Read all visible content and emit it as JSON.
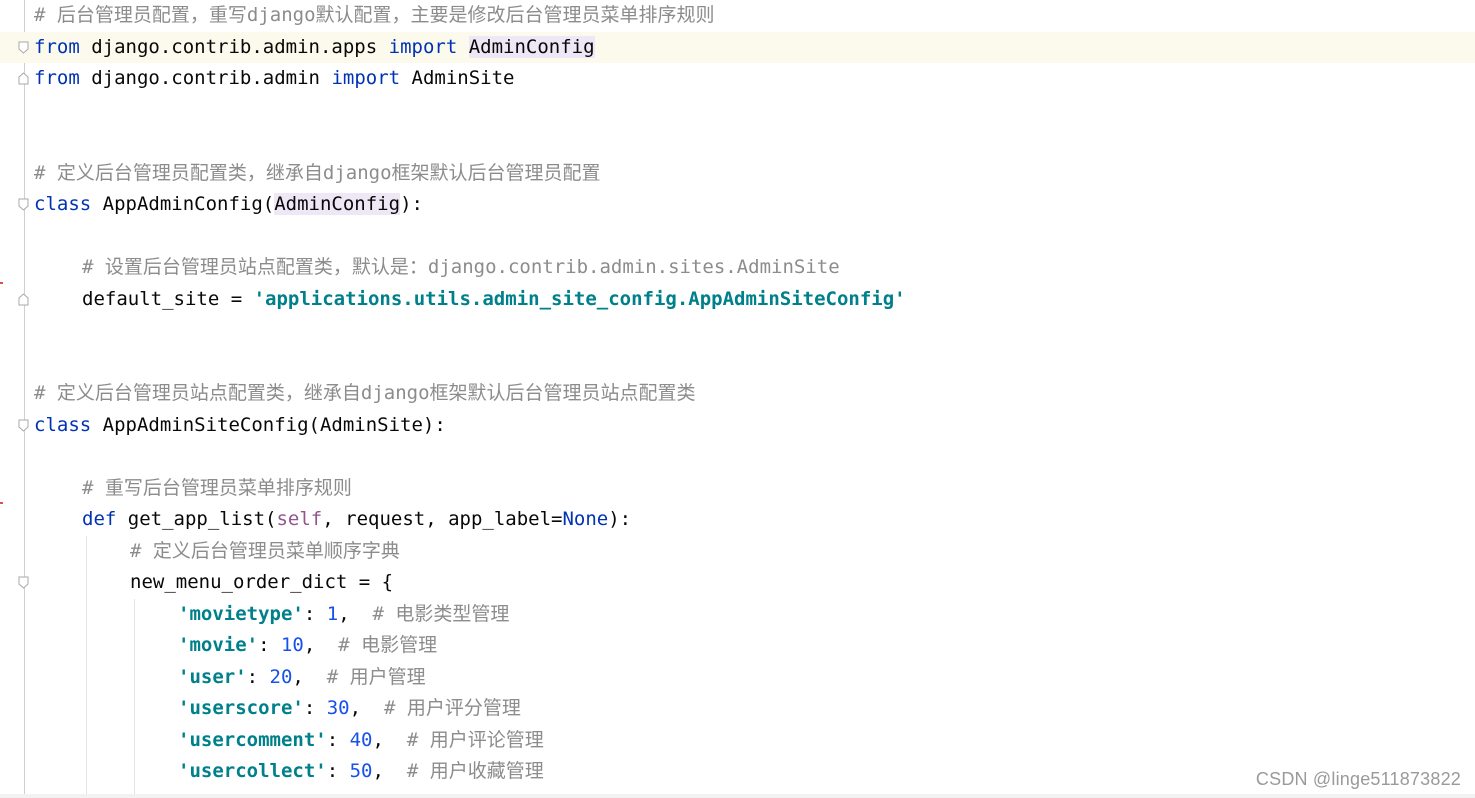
{
  "editor": {
    "lines": [
      {
        "indent": 0,
        "tokens": [
          {
            "t": "# 后台管理员配置，重写django默认配置，主要是修改后台管理员菜单排序规则",
            "c": "cmt"
          }
        ]
      },
      {
        "indent": 0,
        "current": true,
        "fold": "open",
        "tokens": [
          {
            "t": "from",
            "c": "kw"
          },
          {
            "t": " django.contrib.admin.apps ",
            "c": ""
          },
          {
            "t": "import",
            "c": "kw"
          },
          {
            "t": " ",
            "c": ""
          },
          {
            "t": "AdminConfig",
            "c": "hl"
          }
        ]
      },
      {
        "indent": 0,
        "fold": "end",
        "tokens": [
          {
            "t": "from",
            "c": "kw"
          },
          {
            "t": " django.contrib.admin ",
            "c": ""
          },
          {
            "t": "import",
            "c": "kw"
          },
          {
            "t": " AdminSite",
            "c": ""
          }
        ]
      },
      {
        "indent": 0,
        "tokens": []
      },
      {
        "indent": 0,
        "tokens": []
      },
      {
        "indent": 0,
        "tokens": [
          {
            "t": "# 定义后台管理员配置类，继承自django框架默认后台管理员配置",
            "c": "cmt"
          }
        ]
      },
      {
        "indent": 0,
        "fold": "open",
        "tokens": [
          {
            "t": "class",
            "c": "kw"
          },
          {
            "t": " AppAdminConfig(",
            "c": ""
          },
          {
            "t": "AdminConfig",
            "c": "hl"
          },
          {
            "t": "):",
            "c": ""
          }
        ]
      },
      {
        "indent": 0,
        "tokens": []
      },
      {
        "indent": 1,
        "tokens": [
          {
            "t": "# 设置后台管理员站点配置类，默认是：django.contrib.admin.sites.AdminSite",
            "c": "cmt"
          }
        ]
      },
      {
        "indent": 1,
        "fold": "end",
        "err": true,
        "tokens": [
          {
            "t": "default_site = ",
            "c": ""
          },
          {
            "t": "'applications.utils.admin_site_config.AppAdminSiteConfig'",
            "c": "str teal"
          }
        ]
      },
      {
        "indent": 0,
        "tokens": []
      },
      {
        "indent": 0,
        "tokens": []
      },
      {
        "indent": 0,
        "tokens": [
          {
            "t": "# 定义后台管理员站点配置类，继承自django框架默认后台管理员站点配置类",
            "c": "cmt"
          }
        ]
      },
      {
        "indent": 0,
        "fold": "open",
        "tokens": [
          {
            "t": "class",
            "c": "kw"
          },
          {
            "t": " AppAdminSiteConfig(AdminSite):",
            "c": ""
          }
        ]
      },
      {
        "indent": 0,
        "tokens": []
      },
      {
        "indent": 1,
        "tokens": [
          {
            "t": "# 重写后台管理员菜单排序规则",
            "c": "cmt"
          }
        ]
      },
      {
        "indent": 1,
        "err": true,
        "tokens": [
          {
            "t": "def",
            "c": "kw"
          },
          {
            "t": " get_app_list(",
            "c": ""
          },
          {
            "t": "self",
            "c": "self"
          },
          {
            "t": ", request, app_label=",
            "c": ""
          },
          {
            "t": "None",
            "c": "kw"
          },
          {
            "t": "):",
            "c": ""
          }
        ]
      },
      {
        "indent": 2,
        "tokens": [
          {
            "t": "# 定义后台管理员菜单顺序字典",
            "c": "cmt"
          }
        ]
      },
      {
        "indent": 2,
        "fold": "open",
        "tokens": [
          {
            "t": "new_menu_order_dict = {",
            "c": ""
          }
        ]
      },
      {
        "indent": 3,
        "tokens": [
          {
            "t": "'movietype'",
            "c": "str teal"
          },
          {
            "t": ": ",
            "c": ""
          },
          {
            "t": "1",
            "c": "num"
          },
          {
            "t": ",  ",
            "c": ""
          },
          {
            "t": "# 电影类型管理",
            "c": "cmt"
          }
        ]
      },
      {
        "indent": 3,
        "tokens": [
          {
            "t": "'movie'",
            "c": "str teal"
          },
          {
            "t": ": ",
            "c": ""
          },
          {
            "t": "10",
            "c": "num"
          },
          {
            "t": ",  ",
            "c": ""
          },
          {
            "t": "# 电影管理",
            "c": "cmt"
          }
        ]
      },
      {
        "indent": 3,
        "tokens": [
          {
            "t": "'user'",
            "c": "str teal"
          },
          {
            "t": ": ",
            "c": ""
          },
          {
            "t": "20",
            "c": "num"
          },
          {
            "t": ",  ",
            "c": ""
          },
          {
            "t": "# 用户管理",
            "c": "cmt"
          }
        ]
      },
      {
        "indent": 3,
        "tokens": [
          {
            "t": "'userscore'",
            "c": "str teal"
          },
          {
            "t": ": ",
            "c": ""
          },
          {
            "t": "30",
            "c": "num"
          },
          {
            "t": ",  ",
            "c": ""
          },
          {
            "t": "# 用户评分管理",
            "c": "cmt"
          }
        ]
      },
      {
        "indent": 3,
        "tokens": [
          {
            "t": "'usercomment'",
            "c": "str teal"
          },
          {
            "t": ": ",
            "c": ""
          },
          {
            "t": "40",
            "c": "num"
          },
          {
            "t": ",  ",
            "c": ""
          },
          {
            "t": "# 用户评论管理",
            "c": "cmt"
          }
        ]
      },
      {
        "indent": 3,
        "tokens": [
          {
            "t": "'usercollect'",
            "c": "str teal"
          },
          {
            "t": ": ",
            "c": ""
          },
          {
            "t": "50",
            "c": "num"
          },
          {
            "t": ",  ",
            "c": ""
          },
          {
            "t": "# 用户收藏管理",
            "c": "cmt"
          }
        ]
      }
    ]
  },
  "watermark": "CSDN @linge511873822",
  "colors": {
    "keyword": "#0033b3",
    "string": "#00808a",
    "number": "#1750eb",
    "self": "#94558d",
    "comment": "#8c8c8c",
    "current_line": "#fcfaed",
    "highlight": "#ede7f6"
  }
}
